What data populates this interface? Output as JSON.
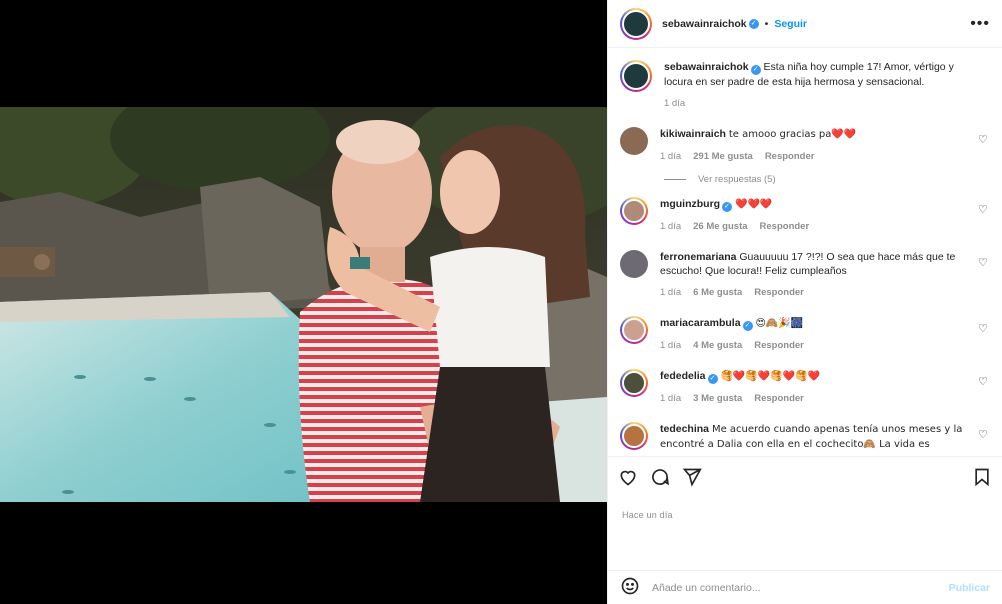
{
  "header": {
    "username": "sebawainraichok",
    "dot": "•",
    "follow_label": "Seguir",
    "more_label": "•••"
  },
  "caption": {
    "username": "sebawainraichok",
    "text": "Esta niña hoy cumple 17! Amor, vértigo y locura en ser padre de esta hija hermosa y sensacional.",
    "time": "1 día"
  },
  "comments": [
    {
      "username": "kikiwainraich",
      "text": "te amooo gracias pa❤️❤️",
      "time": "1 día",
      "likes": "291 Me gusta",
      "reply": "Responder",
      "verified": false
    },
    {
      "username": "mguinzburg",
      "text": "❤️❤️❤️",
      "time": "1 día",
      "likes": "26 Me gusta",
      "reply": "Responder",
      "verified": true
    },
    {
      "username": "ferronemariana",
      "text": "Guauuuuu 17 ?!?! O sea que hace más que te escucho! Que locura!! Feliz cumpleaños",
      "time": "1 día",
      "likes": "6 Me gusta",
      "reply": "Responder",
      "verified": false
    },
    {
      "username": "mariacarambula",
      "text": "😍🙈🎉🎆",
      "time": "1 día",
      "likes": "4 Me gusta",
      "reply": "Responder",
      "verified": true
    },
    {
      "username": "fededelia",
      "text": "🥞❤️🥞❤️🥞❤️🥞❤️",
      "time": "1 día",
      "likes": "3 Me gusta",
      "reply": "Responder",
      "verified": true
    },
    {
      "username": "tedechina",
      "text": "Me acuerdo cuando apenas tenía unos meses y la encontré a Dalia con ella en el cochecito🙈 La vida es",
      "verified": false
    }
  ],
  "view_replies": "Ver respuestas (5)",
  "post_time": "Hace un día",
  "add_comment": {
    "placeholder": "Añade un comentario...",
    "publish": "Publicar"
  },
  "colors": {
    "accent": "#0095f6",
    "verified": "#3897f0",
    "muted": "#8e8e8e"
  },
  "icons": [
    "heart-icon",
    "comment-icon",
    "share-icon",
    "bookmark-icon",
    "emoji-icon",
    "more-icon"
  ]
}
